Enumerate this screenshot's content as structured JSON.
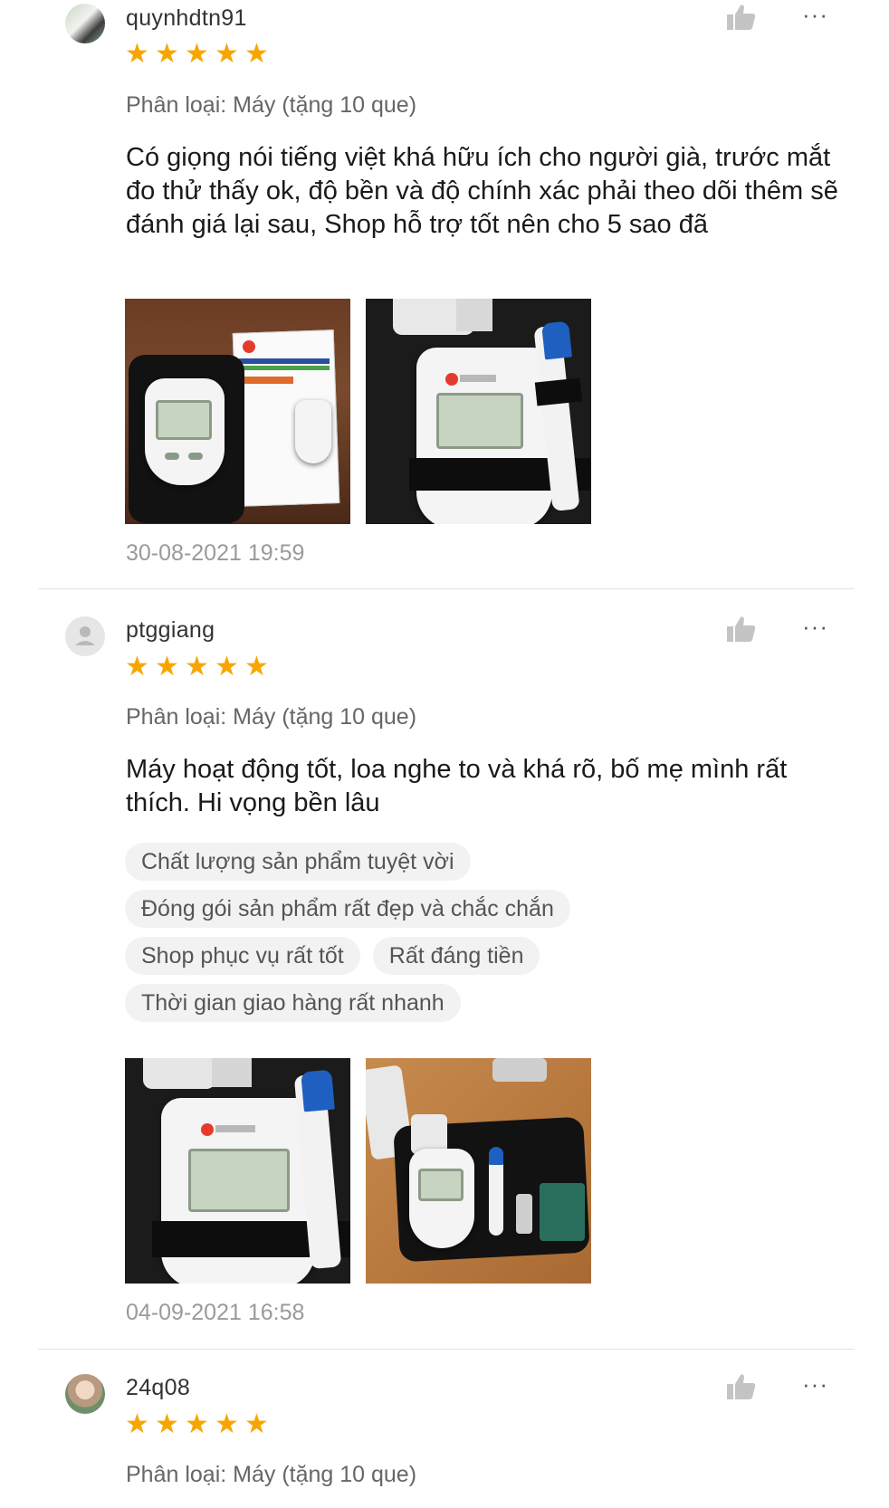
{
  "reviews": [
    {
      "username": "quynhdtn91",
      "variant": "Phân loại: Máy (tặng 10 que)",
      "comment": "Có giọng nói tiếng việt khá hữu ích cho người già, trước mắt đo thử thấy ok, độ bền và độ chính xác phải theo dõi thêm sẽ đánh giá lại sau, Shop hỗ trợ tốt nên cho 5 sao đã",
      "date": "30-08-2021 19:59",
      "rating": 5
    },
    {
      "username": "ptggiang",
      "variant": "Phân loại: Máy (tặng 10 que)",
      "comment": "Máy hoạt động tốt, loa nghe to và khá rõ, bố mẹ mình rất thích. Hi vọng bền lâu",
      "tags": [
        "Chất lượng sản phẩm tuyệt vời",
        "Đóng gói sản phẩm rất đẹp và chắc chắn",
        "Shop phục vụ rất tốt",
        "Rất đáng tiền",
        "Thời gian giao hàng rất nhanh"
      ],
      "date": "04-09-2021 16:58",
      "rating": 5
    },
    {
      "username": "24q08",
      "variant": "Phân loại: Máy (tặng 10 que)",
      "rating": 5
    }
  ],
  "icons": {
    "like": "thumbs-up-icon",
    "more": "more-options-icon",
    "star": "star-icon",
    "default_avatar": "user-avatar-icon"
  },
  "colors": {
    "star": "#f7a600",
    "muted_text": "#9a9a9a",
    "tag_bg": "#f2f2f2"
  }
}
